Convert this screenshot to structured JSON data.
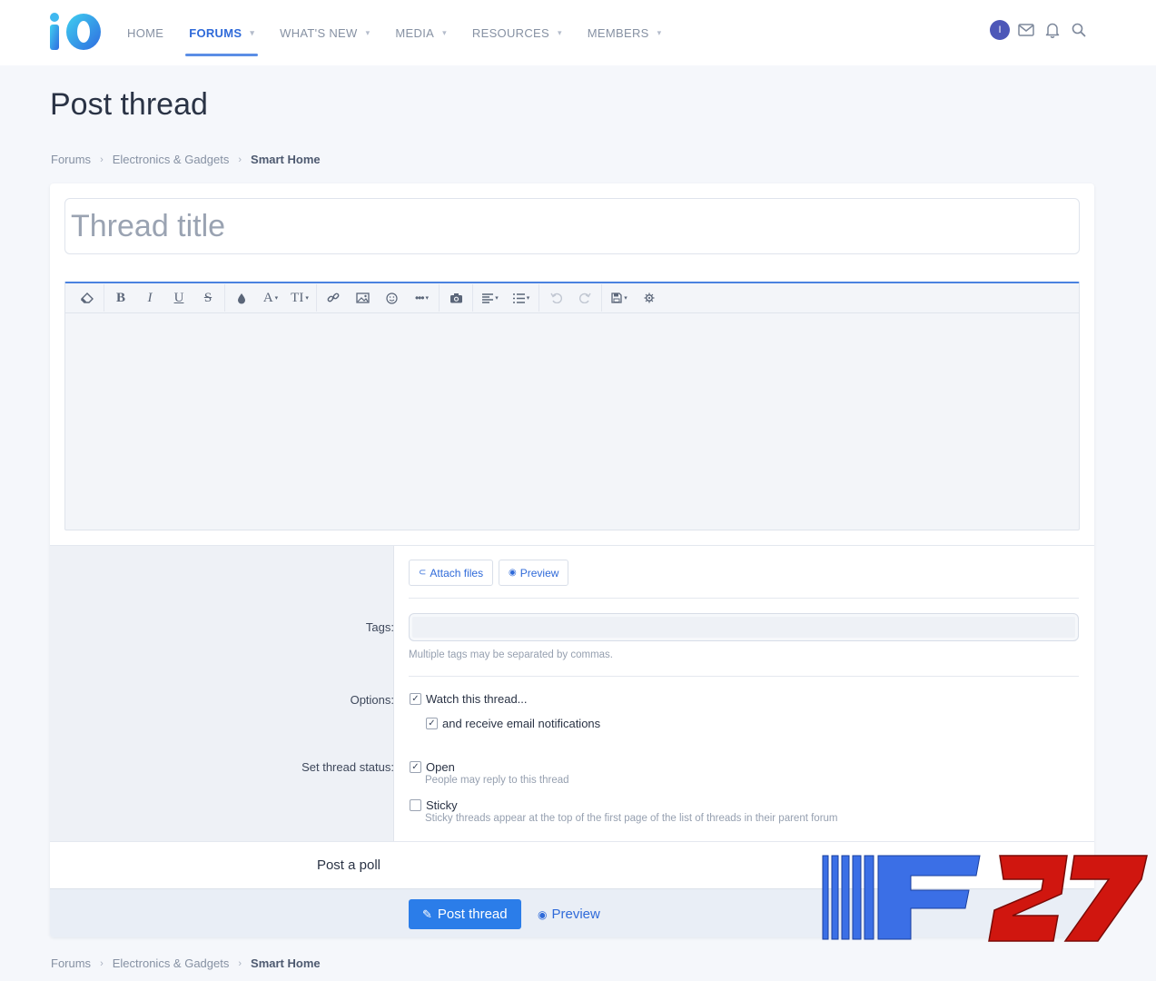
{
  "brand": {
    "logo_text": "iO"
  },
  "nav": [
    {
      "label": "HOME",
      "has_caret": false,
      "active": false
    },
    {
      "label": "FORUMS",
      "has_caret": true,
      "active": true
    },
    {
      "label": "WHAT'S NEW",
      "has_caret": true,
      "active": false
    },
    {
      "label": "MEDIA",
      "has_caret": true,
      "active": false
    },
    {
      "label": "RESOURCES",
      "has_caret": true,
      "active": false
    },
    {
      "label": "MEMBERS",
      "has_caret": true,
      "active": false
    }
  ],
  "user": {
    "avatar_initial": "I",
    "icons": [
      "avatar",
      "envelope-icon",
      "bell-icon",
      "search-icon"
    ]
  },
  "page": {
    "title": "Post thread"
  },
  "breadcrumb": {
    "items": [
      "Forums",
      "Electronics & Gadgets"
    ],
    "current": "Smart Home"
  },
  "form": {
    "title_placeholder": "Thread title",
    "attach_label": "Attach files",
    "preview_label": "Preview",
    "tags_label": "Tags:",
    "tags_hint": "Multiple tags may be separated by commas.",
    "options_label": "Options:",
    "watch_label": "Watch this thread...",
    "email_label": "and receive email notifications",
    "status_label": "Set thread status:",
    "open_label": "Open",
    "open_hint": "People may reply to this thread",
    "sticky_label": "Sticky",
    "sticky_hint": "Sticky threads appear at the top of the first page of the list of threads in their parent forum",
    "watch_checked": true,
    "email_checked": true,
    "open_checked": true,
    "sticky_checked": false,
    "poll_label": "Post a poll",
    "submit_label": "Post thread",
    "submit_preview_label": "Preview"
  },
  "editor_toolbar": [
    "eraser-icon",
    "bold-icon",
    "italic-icon",
    "underline-icon",
    "strikethrough-icon",
    "text-color-icon",
    "font-family-icon",
    "font-size-icon",
    "link-icon",
    "image-icon",
    "smiley-icon",
    "more-icon",
    "media-icon",
    "align-icon",
    "list-icon",
    "undo-icon",
    "redo-icon",
    "drafts-icon",
    "settings-icon"
  ],
  "watermark": {
    "text": "F27"
  },
  "colors": {
    "accent": "#2f6ad9",
    "button": "#2b7de9",
    "background": "#f5f7fb",
    "avatar": "#4d57b8",
    "watermark_red": "#d0160f",
    "watermark_blue": "#3b6fe6"
  }
}
